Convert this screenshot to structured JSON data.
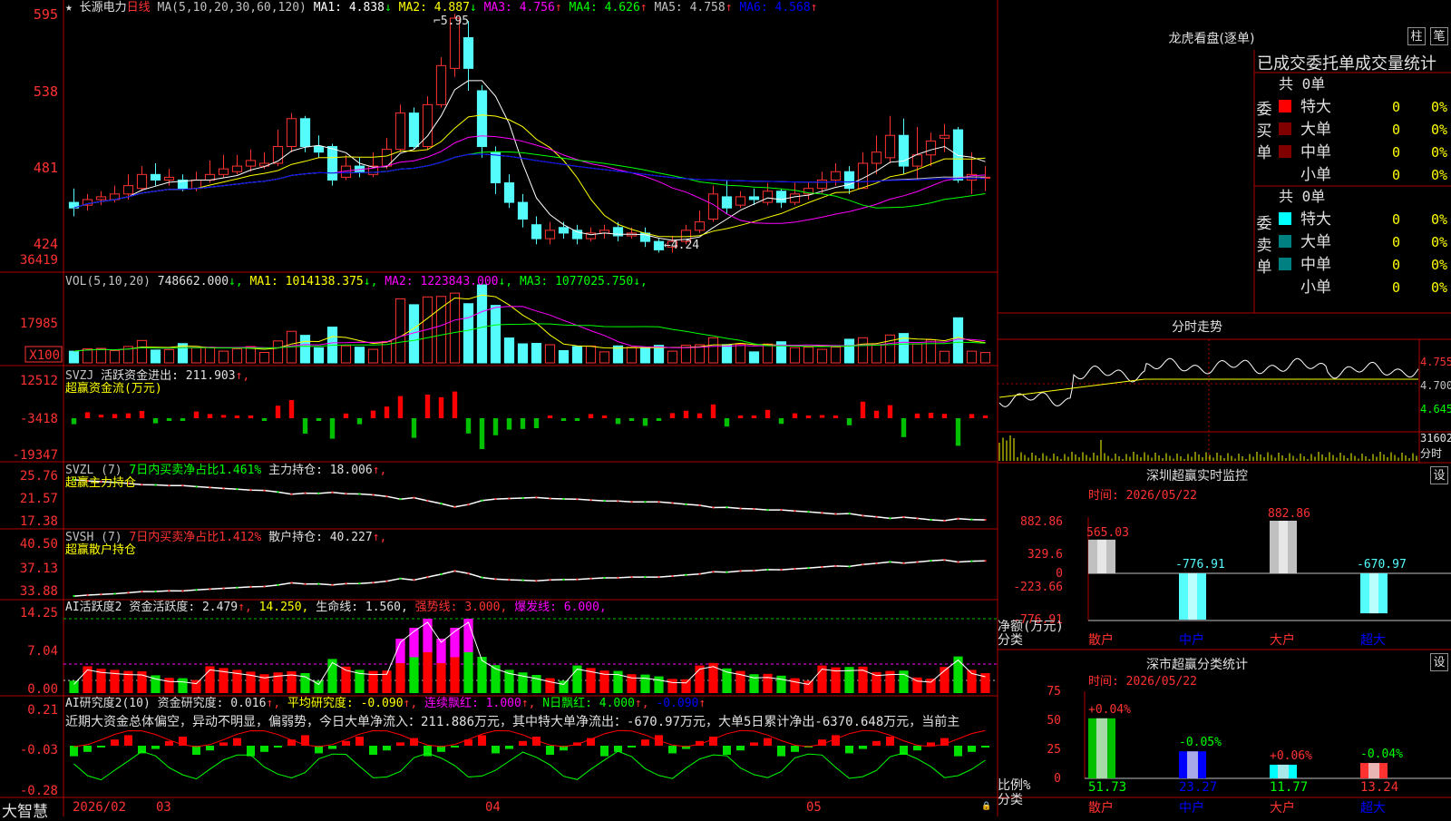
{
  "colors": {
    "up": "#ff3232",
    "down": "#54fcfc",
    "grid": "#b00000",
    "ma1": "#ffffff",
    "ma2": "#ffff00",
    "ma3": "#ff00ff",
    "ma4": "#00ff00",
    "ma5": "#c0c0c0",
    "ma6": "#0000ff",
    "dark_red": "#800000",
    "teal": "#008080"
  },
  "bottom": {
    "brand": "大智慧",
    "date_label": "2026/02",
    "month_labels": [
      "03",
      "04",
      "05"
    ]
  },
  "kline": {
    "title_star": "★",
    "stock_name": "长源电力",
    "period": "日线",
    "ma_params": "MA(5,10,20,30,60,120)",
    "ma": [
      {
        "label": "MA1:",
        "value": "4.838",
        "arrow": "↓",
        "color": "#ffffff"
      },
      {
        "label": "MA2:",
        "value": "4.887",
        "arrow": "↓",
        "color": "#ffff00"
      },
      {
        "label": "MA3:",
        "value": "4.756",
        "arrow": "↑",
        "color": "#ff00ff"
      },
      {
        "label": "MA4:",
        "value": "4.626",
        "arrow": "↑",
        "color": "#00ff00"
      },
      {
        "label": "MA5:",
        "value": "4.758",
        "arrow": "↑",
        "color": "#c0c0c0"
      },
      {
        "label": "MA6:",
        "value": "4.568",
        "arrow": "↑",
        "color": "#0000ff"
      }
    ],
    "yticks": [
      "595",
      "538",
      "481",
      "424"
    ],
    "high_label": "5.95",
    "low_label": "4.24"
  },
  "vol": {
    "title": "VOL(5,10,20)",
    "value": "748662.000",
    "arrow": "↓",
    "ma": [
      {
        "label": "MA1:",
        "value": "1014138.375",
        "arrow": "↓",
        "color": "#ffff00"
      },
      {
        "label": "MA2:",
        "value": "1223843.000",
        "arrow": "↓",
        "color": "#ff00ff"
      },
      {
        "label": "MA3:",
        "value": "1077025.750",
        "arrow": "↓",
        "color": "#00ff00"
      }
    ],
    "yticks": [
      "36419",
      "17985"
    ],
    "unit": "X100"
  },
  "svzj": {
    "title": "SVZJ",
    "label": "活跃资金进出:",
    "value": "211.903",
    "arrow": "↑",
    "subtitle": "超赢资金流(万元)",
    "yticks": [
      "12512",
      "-3418",
      "-19347"
    ]
  },
  "svzl": {
    "title": "SVZL (7)",
    "green_label": "7日内买卖净占比1.461%",
    "label": "主力持仓:",
    "value": "18.006",
    "arrow": "↑",
    "subtitle": "超赢主力持仓",
    "yticks": [
      "25.76",
      "21.57",
      "17.38"
    ]
  },
  "svsh": {
    "title": "SVSH (7)",
    "red_label": "7日内买卖净占比1.412%",
    "label": "散户持仓:",
    "value": "40.227",
    "arrow": "↑",
    "subtitle": "超赢散户持仓",
    "yticks": [
      "40.50",
      "37.13",
      "33.88"
    ]
  },
  "ai_active": {
    "title": "AI活跃度2",
    "label": "资金活跃度:",
    "value": "2.479",
    "arrow": "↑",
    "yellow_value": "14.250",
    "life_label": "生命线:",
    "life_value": "1.560",
    "strong_label": "强势线:",
    "strong_value": "3.000",
    "burst_label": "爆发线:",
    "burst_value": "6.000",
    "yticks": [
      "14.25",
      "7.04",
      "0.00"
    ]
  },
  "ai_research": {
    "title": "AI研究度2(10)",
    "label": "资金研究度:",
    "value": "0.016",
    "avg_label": "平均研究度:",
    "avg_value": "-0.090",
    "lian_label": "连续飘红:",
    "lian_value": "1.000",
    "n_label": "N日飘红:",
    "n_value": "4.000",
    "last_value": "-0.090",
    "arrow": "↑",
    "description": "近期大资金总体偏空，异动不明显，偏弱势，今日大单净流入：211.886万元，其中特大单净流出：-670.97万元，大单5日累计净出-6370.648万元，当前主",
    "yticks": [
      "0.21",
      "-0.03",
      "-0.28"
    ]
  },
  "right": {
    "lhb_title": "龙虎看盘(逐单)",
    "btn_bar": "柱",
    "btn_pen": "笔",
    "tabs_header": "已成交委托单成交量统计",
    "buy_side": "委买单",
    "sell_side": "委卖单",
    "total_label": "共",
    "total_value": "0单",
    "buy_rows": [
      {
        "label": "特大",
        "value": "0",
        "pct": "0%",
        "color": "#ff0000"
      },
      {
        "label": "大单",
        "value": "0",
        "pct": "0%",
        "color": "#800000"
      },
      {
        "label": "中单",
        "value": "0",
        "pct": "0%",
        "color": "#800000"
      },
      {
        "label": "小单",
        "value": "0",
        "pct": "0%",
        "color": ""
      }
    ],
    "sell_rows": [
      {
        "label": "特大",
        "value": "0",
        "pct": "0%",
        "color": "#00ffff"
      },
      {
        "label": "大单",
        "value": "0",
        "pct": "0%",
        "color": "#008080"
      },
      {
        "label": "中单",
        "value": "0",
        "pct": "0%",
        "color": "#008080"
      },
      {
        "label": "小单",
        "value": "0",
        "pct": "0%",
        "color": ""
      }
    ],
    "intraday_title": "分时走势",
    "intraday_prices": [
      "4.755",
      "4.700",
      "4.645"
    ],
    "intraday_vol": "31602",
    "intraday_unit": "分时",
    "monitor_title": "深圳超赢实时监控",
    "monitor_btn": "设",
    "monitor_time": "时间: 2026/05/22",
    "monitor_yticks": [
      "882.86",
      "329.6",
      "0",
      "-223.66",
      "-776.91"
    ],
    "monitor_ylabel": "净额(万元)",
    "monitor_xlabel": "分类",
    "monitor_cats": [
      "散户",
      "中户",
      "大户",
      "超大"
    ],
    "monitor_values": [
      565.03,
      -776.91,
      882.86,
      -670.97
    ],
    "monitor_value_labels": [
      "565.03",
      "-776.91",
      "882.86",
      "-670.97"
    ],
    "class_title": "深市超赢分类统计",
    "class_btn": "设",
    "class_time": "时间: 2026/05/22",
    "class_yticks": [
      "75",
      "50",
      "25",
      "0"
    ],
    "class_ylabel": "比例%",
    "class_xlabel": "分类",
    "class_pct_changes": [
      "+0.04%",
      "-0.05%",
      "+0.06%",
      "-0.04%"
    ],
    "class_values": [
      51.73,
      23.27,
      11.77,
      13.24
    ],
    "class_value_labels": [
      "51.73",
      "23.27",
      "11.77",
      "13.24"
    ],
    "class_cats": [
      "散户",
      "中户",
      "大户",
      "超大"
    ]
  },
  "chart_data": [
    {
      "type": "candlestick",
      "title": "长源电力 日线",
      "x": [
        "2026/02",
        "03",
        "04",
        "05"
      ],
      "price_range": [
        4.1,
        6.05
      ],
      "high": 5.95,
      "low": 4.24,
      "candles": [
        [
          4.6,
          4.56,
          4.7,
          4.5
        ],
        [
          4.58,
          4.62,
          4.66,
          4.54
        ],
        [
          4.62,
          4.64,
          4.68,
          4.58
        ],
        [
          4.62,
          4.66,
          4.72,
          4.6
        ],
        [
          4.66,
          4.72,
          4.8,
          4.62
        ],
        [
          4.7,
          4.8,
          4.86,
          4.68
        ],
        [
          4.8,
          4.76,
          4.88,
          4.72
        ],
        [
          4.76,
          4.78,
          4.84,
          4.72
        ],
        [
          4.76,
          4.7,
          4.8,
          4.68
        ],
        [
          4.7,
          4.76,
          4.82,
          4.68
        ],
        [
          4.76,
          4.8,
          4.9,
          4.74
        ],
        [
          4.8,
          4.84,
          4.94,
          4.78
        ],
        [
          4.82,
          4.86,
          4.94,
          4.8
        ],
        [
          4.86,
          4.9,
          4.98,
          4.82
        ],
        [
          4.86,
          4.88,
          4.96,
          4.84
        ],
        [
          4.88,
          5.0,
          5.12,
          4.86
        ],
        [
          5.0,
          5.2,
          5.24,
          4.96
        ],
        [
          5.2,
          5.0,
          5.22,
          4.96
        ],
        [
          5.0,
          4.96,
          5.08,
          4.92
        ],
        [
          5.0,
          4.76,
          5.02,
          4.72
        ],
        [
          4.78,
          4.86,
          4.94,
          4.76
        ],
        [
          4.86,
          4.82,
          4.92,
          4.78
        ],
        [
          4.8,
          4.86,
          4.96,
          4.78
        ],
        [
          4.86,
          4.98,
          5.06,
          4.84
        ],
        [
          4.98,
          5.24,
          5.3,
          4.96
        ],
        [
          5.24,
          5.0,
          5.28,
          4.98
        ],
        [
          5.0,
          5.3,
          5.36,
          4.98
        ],
        [
          5.3,
          5.58,
          5.64,
          5.28
        ],
        [
          5.56,
          5.92,
          5.95,
          5.5
        ],
        [
          5.78,
          5.56,
          5.9,
          5.4
        ],
        [
          5.4,
          5.0,
          5.44,
          4.92
        ],
        [
          4.96,
          4.74,
          5.0,
          4.66
        ],
        [
          4.74,
          4.6,
          4.8,
          4.56
        ],
        [
          4.6,
          4.48,
          4.66,
          4.42
        ],
        [
          4.44,
          4.34,
          4.5,
          4.3
        ],
        [
          4.34,
          4.4,
          4.46,
          4.3
        ],
        [
          4.42,
          4.38,
          4.46,
          4.34
        ],
        [
          4.4,
          4.34,
          4.44,
          4.3
        ],
        [
          4.34,
          4.38,
          4.42,
          4.32
        ],
        [
          4.38,
          4.4,
          4.44,
          4.34
        ],
        [
          4.42,
          4.36,
          4.46,
          4.32
        ],
        [
          4.36,
          4.38,
          4.42,
          4.34
        ],
        [
          4.38,
          4.32,
          4.42,
          4.28
        ],
        [
          4.32,
          4.26,
          4.34,
          4.24
        ],
        [
          4.28,
          4.32,
          4.36,
          4.24
        ],
        [
          4.32,
          4.4,
          4.44,
          4.3
        ],
        [
          4.4,
          4.46,
          4.54,
          4.38
        ],
        [
          4.48,
          4.66,
          4.72,
          4.46
        ],
        [
          4.64,
          4.56,
          4.76,
          4.52
        ],
        [
          4.58,
          4.64,
          4.68,
          4.56
        ],
        [
          4.64,
          4.62,
          4.7,
          4.58
        ],
        [
          4.6,
          4.68,
          4.74,
          4.58
        ],
        [
          4.68,
          4.6,
          4.7,
          4.56
        ],
        [
          4.6,
          4.66,
          4.74,
          4.58
        ],
        [
          4.66,
          4.7,
          4.74,
          4.62
        ],
        [
          4.7,
          4.76,
          4.82,
          4.66
        ],
        [
          4.76,
          4.82,
          4.88,
          4.72
        ],
        [
          4.82,
          4.7,
          4.86,
          4.66
        ],
        [
          4.7,
          4.88,
          4.96,
          4.7
        ],
        [
          4.88,
          4.96,
          5.08,
          4.8
        ],
        [
          4.92,
          5.08,
          5.22,
          4.88
        ],
        [
          5.08,
          4.86,
          5.2,
          4.8
        ],
        [
          4.86,
          4.94,
          5.14,
          4.76
        ],
        [
          4.94,
          5.04,
          5.1,
          4.86
        ],
        [
          5.06,
          5.08,
          5.16,
          4.96
        ],
        [
          5.12,
          4.76,
          5.14,
          4.74
        ],
        [
          4.76,
          4.8,
          4.96,
          4.66
        ],
        [
          4.78,
          4.78,
          4.86,
          4.68
        ]
      ]
    }
  ]
}
